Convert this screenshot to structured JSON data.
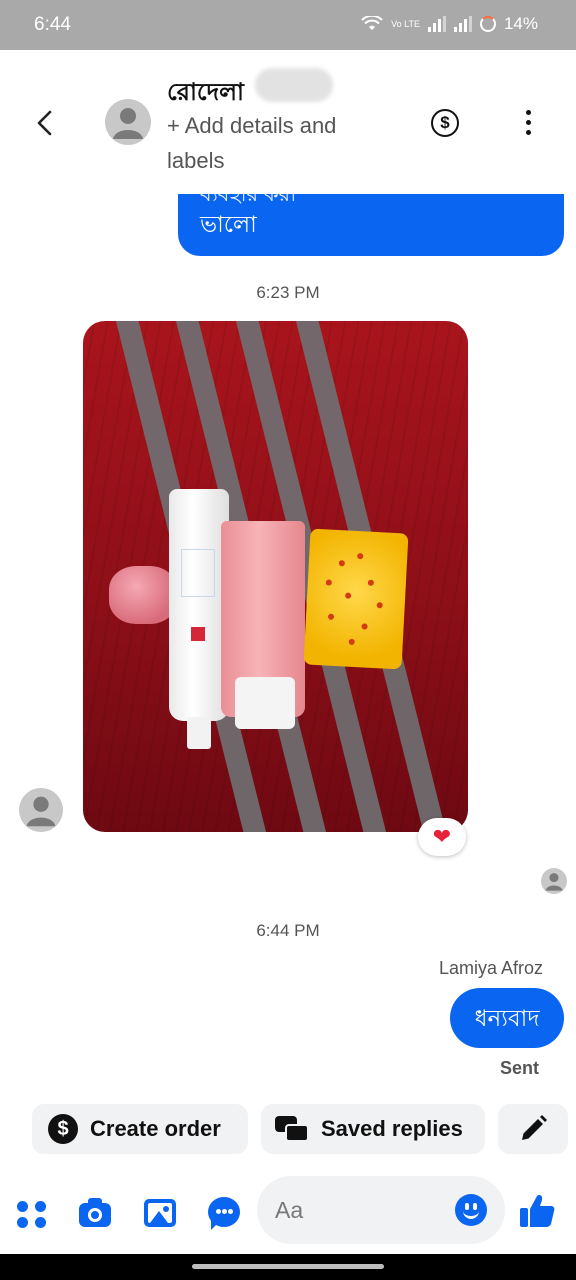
{
  "status_bar": {
    "time": "6:44",
    "volte": "Vo LTE",
    "battery": "14%"
  },
  "header": {
    "contact_name": "রোদেলা",
    "add_details": "+ Add details and labels"
  },
  "messages": {
    "prev_bubble_text": "ভালো",
    "prev_bubble_cut_text": "ব্যবহার করা",
    "time_1": "6:23 PM",
    "reaction": "❤",
    "time_2": "6:44 PM",
    "sender_name": "Lamiya Afroz",
    "sent_text": "ধন্যবাদ",
    "sent_status": "Sent"
  },
  "quick_replies": {
    "create_order": "Create order",
    "saved_replies": "Saved replies"
  },
  "composer": {
    "placeholder": "Aa"
  },
  "colors": {
    "accent": "#0a66f0",
    "status_bar": "#a9a9a9",
    "chip_bg": "#f1f2f4",
    "reaction_heart": "#e8213a"
  }
}
